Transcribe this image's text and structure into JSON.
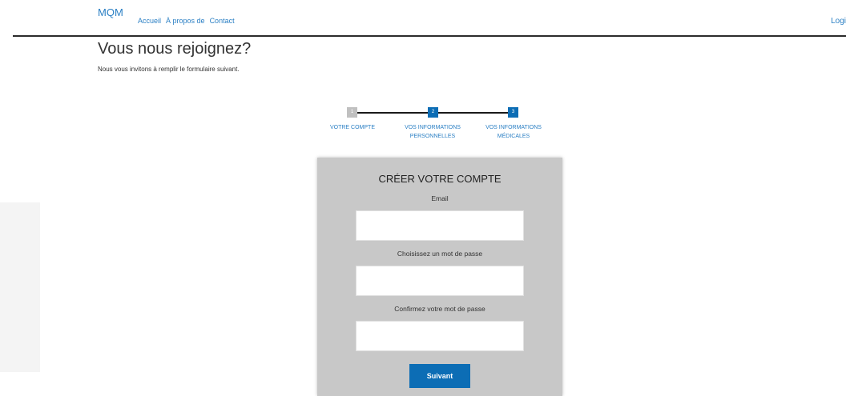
{
  "navbar": {
    "brand": "MQM",
    "links": [
      "Accueil",
      "À propos de",
      "Contact"
    ],
    "login": "Logi"
  },
  "heading": {
    "title": "Vous nous rejoignez?",
    "subtitle": "Nous vous invitons à remplir le formulaire suivant."
  },
  "stepper": {
    "steps": [
      {
        "number": "1",
        "label_line1": "VOTRE COMPTE",
        "label_line2": "",
        "state": "done"
      },
      {
        "number": "2",
        "label_line1": "VOS INFORMATIONS",
        "label_line2": "PERSONNELLES",
        "state": "active"
      },
      {
        "number": "3",
        "label_line1": "VOS INFORMATIONS",
        "label_line2": "MÉDICALES",
        "state": "active"
      }
    ]
  },
  "form": {
    "title": "CRÉER VOTRE COMPTE",
    "email_label": "Email",
    "email_value": "",
    "password_label": "Choisissez un mot de passe",
    "password_value": "",
    "confirm_label": "Confirmez votre mot de passe",
    "confirm_value": "",
    "submit_label": "Suivant"
  },
  "colors": {
    "accent": "#0c6db5",
    "link": "#2a7fc4",
    "card_background": "#c8c8c8",
    "step_inactive": "#c0c0c0"
  }
}
